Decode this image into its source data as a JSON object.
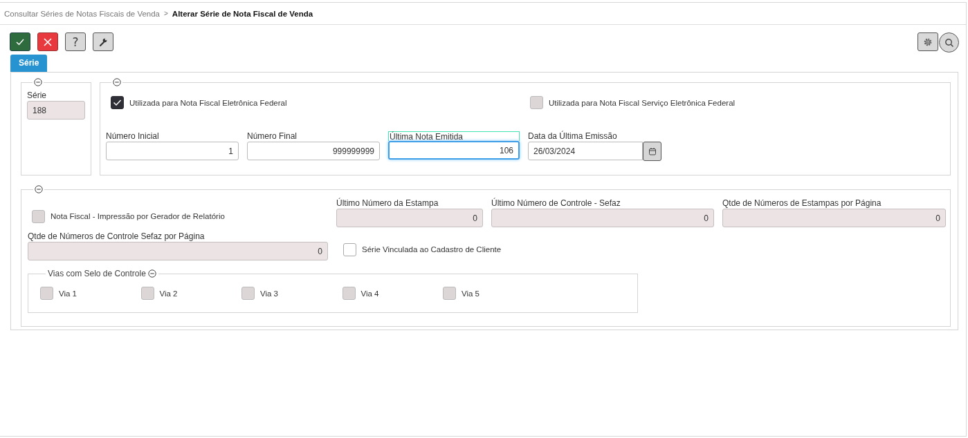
{
  "breadcrumb": {
    "items": [
      {
        "label": "Consultar Séries de Notas Fiscais de Venda",
        "current": false
      },
      {
        "label": "Alterar Série de Nota Fiscal de Venda",
        "current": true
      }
    ],
    "separator": ">"
  },
  "toolbar": {
    "left": [
      {
        "kind": "confirm"
      },
      {
        "kind": "cancel"
      },
      {
        "kind": "help",
        "label": "?"
      },
      {
        "kind": "tools"
      }
    ],
    "right": [
      {
        "kind": "settings"
      },
      {
        "kind": "search"
      }
    ]
  },
  "tabs": [
    {
      "label": "Série",
      "selected": true
    }
  ],
  "serie_group": {
    "expanded": true,
    "field": {
      "label": "Série",
      "value": "188",
      "disabled": true,
      "focused": false
    }
  },
  "nfe_group": {
    "expanded": true,
    "checkboxes": [
      {
        "label": "Utilizada para Nota Fiscal Eletrônica Federal",
        "checked": true,
        "disabled": false
      },
      {
        "label": "Utilizada para Nota Fiscal Serviço Eletrônica Federal",
        "checked": false,
        "disabled": true
      }
    ],
    "fields": [
      {
        "label": "Número Inicial",
        "value": "1",
        "kind": "number",
        "disabled": false,
        "focused": false
      },
      {
        "label": "Número Final",
        "value": "999999999",
        "kind": "number",
        "disabled": false,
        "focused": false
      },
      {
        "label": "Última Nota Emitida",
        "value": "106",
        "kind": "number",
        "disabled": false,
        "focused": true
      },
      {
        "label": "Data da Última Emissão",
        "value": "26/03/2024",
        "kind": "date",
        "disabled": false,
        "focused": false
      }
    ]
  },
  "print_group": {
    "expanded": true,
    "print_checkbox": {
      "label": "Nota Fiscal - Impressão por Gerador de Relatório",
      "checked": false,
      "disabled": true
    },
    "fields": [
      {
        "label": "Último Número da Estampa",
        "value": "0",
        "kind": "number",
        "disabled": true,
        "focused": false
      },
      {
        "label": "Último Número de Controle - Sefaz",
        "value": "0",
        "kind": "number",
        "disabled": true,
        "focused": false
      },
      {
        "label": "Qtde de Números de Estampas por Página",
        "value": "0",
        "kind": "number",
        "disabled": true,
        "focused": false
      },
      {
        "label": "Qtde de Números de Controle Sefaz por Página",
        "value": "0",
        "kind": "number",
        "disabled": true,
        "focused": false
      }
    ],
    "client_checkbox": {
      "label": "Série Vinculada ao Cadastro de Cliente",
      "checked": false,
      "disabled": false
    },
    "vias": {
      "legend": "Vias com Selo de Controle",
      "expanded": true,
      "items": [
        {
          "label": "Via 1",
          "checked": false,
          "disabled": true
        },
        {
          "label": "Via 2",
          "checked": false,
          "disabled": true
        },
        {
          "label": "Via 3",
          "checked": false,
          "disabled": true
        },
        {
          "label": "Via 4",
          "checked": false,
          "disabled": true
        },
        {
          "label": "Via 5",
          "checked": false,
          "disabled": true
        }
      ]
    }
  }
}
